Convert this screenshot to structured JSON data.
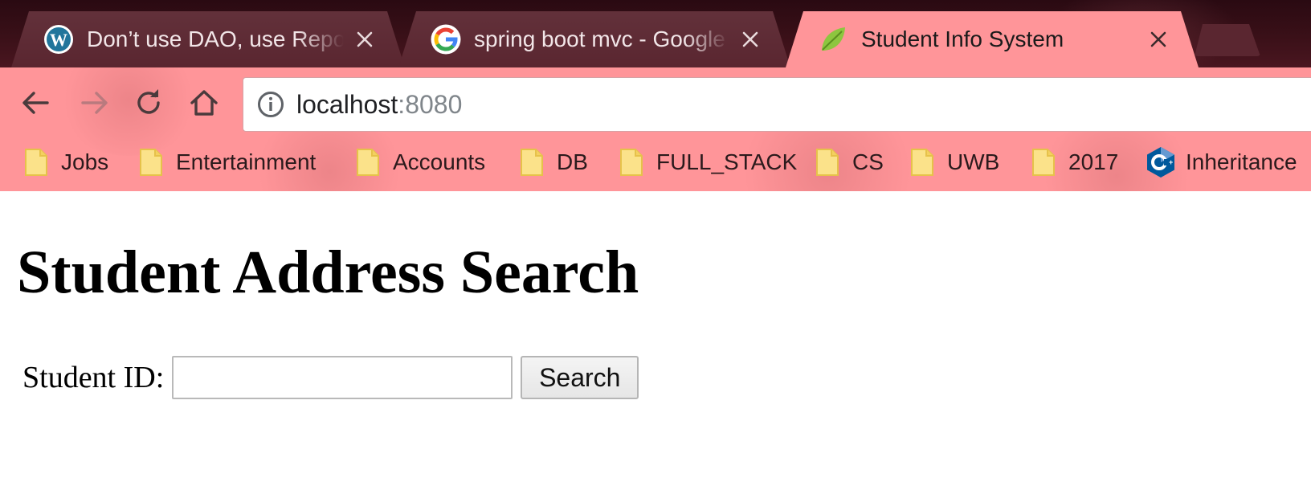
{
  "browser": {
    "tabs": [
      {
        "title": "Don’t use DAO, use Repository",
        "favicon": "wordpress-icon",
        "active": false
      },
      {
        "title": "spring boot mvc - Google Search",
        "favicon": "google-icon",
        "active": false
      },
      {
        "title": "Student Info System",
        "favicon": "spring-leaf-icon",
        "active": true
      }
    ],
    "new_tab_icon": "new-tab-icon",
    "nav_icons": [
      "back-arrow-icon",
      "forward-arrow-icon",
      "reload-icon",
      "home-icon"
    ],
    "address": {
      "host": "localhost",
      "port": ":8080",
      "icon": "info-icon"
    },
    "bookmarks": [
      {
        "label": "Jobs",
        "icon": "folder-icon"
      },
      {
        "label": "Entertainment",
        "icon": "folder-icon"
      },
      {
        "label": "Accounts",
        "icon": "folder-icon"
      },
      {
        "label": "DB",
        "icon": "folder-icon"
      },
      {
        "label": "FULL_STACK",
        "icon": "folder-icon"
      },
      {
        "label": "CS",
        "icon": "folder-icon"
      },
      {
        "label": "UWB",
        "icon": "folder-icon"
      },
      {
        "label": "2017",
        "icon": "folder-icon"
      },
      {
        "label": "Inheritance",
        "icon": "cpp-icon"
      }
    ],
    "colors": {
      "frame": "#3a1018",
      "active_tab": "#ff9599",
      "inactive_tab": "#5a2630"
    }
  },
  "page": {
    "title": "Student Address Search",
    "form": {
      "student_id_label": "Student ID:",
      "student_id_value": "",
      "search_button_label": "Search"
    }
  }
}
